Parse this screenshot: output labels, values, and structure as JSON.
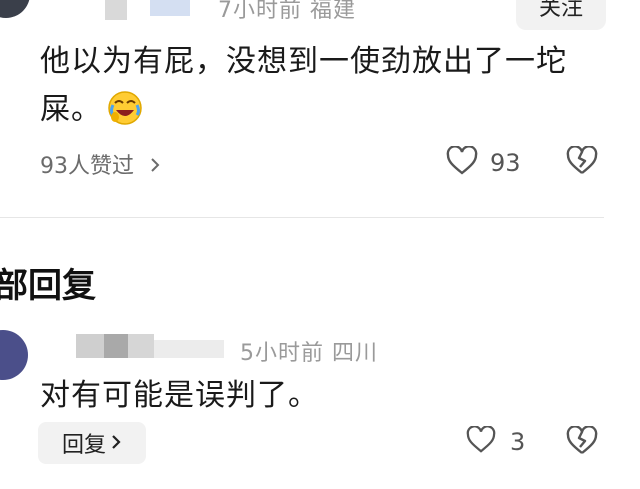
{
  "top_comment": {
    "meta": "7小时前  福建",
    "follow_label": "关注",
    "text": "他以为有屁，没想到一使劲放出了一坨屎。",
    "emoji": "laughing-crying-emoji",
    "likes_summary": "93人赞过",
    "like_count": "93"
  },
  "replies": {
    "section_title": "部回复",
    "item": {
      "meta": "5小时前  四川",
      "text": "对有可能是误判了。",
      "reply_label": "回复",
      "like_count": "3"
    }
  },
  "colors": {
    "text": "#1a1a1a",
    "muted": "#9a9a9a",
    "button_bg": "#f2f2f2"
  }
}
